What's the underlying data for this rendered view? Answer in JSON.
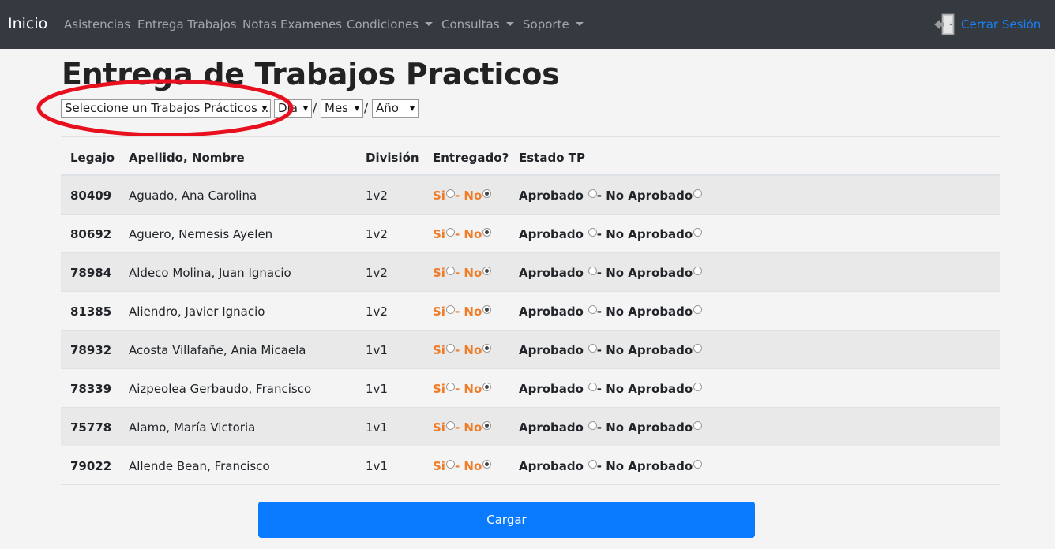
{
  "navbar": {
    "brand": "Inicio",
    "items": [
      {
        "label": "Asistencias",
        "dropdown": false
      },
      {
        "label": "Entrega Trabajos",
        "dropdown": false
      },
      {
        "label": "Notas Examenes",
        "dropdown": false
      },
      {
        "label": "Condiciones",
        "dropdown": true
      },
      {
        "label": "Consultas",
        "dropdown": true
      },
      {
        "label": "Soporte",
        "dropdown": true
      }
    ],
    "logout": {
      "label": "Cerrar Sesión",
      "icon": "logout-door-icon"
    }
  },
  "page": {
    "title": "Entrega de Trabajos Practicos",
    "selects": {
      "tp": "Seleccione un Trabajos Prácticos ...",
      "dia": "Día",
      "mes": "Mes",
      "anio": "Año"
    }
  },
  "table": {
    "headers": {
      "legajo": "Legajo",
      "nombre": "Apellido, Nombre",
      "division": "División",
      "entregado": "Entregado?",
      "estado": "Estado TP"
    },
    "labels": {
      "si": "Si",
      "sep": "- ",
      "no": "No",
      "aprobado": "Aprobado",
      "sep2": "- ",
      "no_aprobado": "No Aprobado"
    },
    "rows": [
      {
        "legajo": "80409",
        "nombre": "Aguado, Ana Carolina",
        "division": "1v2"
      },
      {
        "legajo": "80692",
        "nombre": "Aguero, Nemesis Ayelen",
        "division": "1v2"
      },
      {
        "legajo": "78984",
        "nombre": "Aldeco Molina, Juan Ignacio",
        "division": "1v2"
      },
      {
        "legajo": "81385",
        "nombre": "Aliendro, Javier Ignacio",
        "division": "1v2"
      },
      {
        "legajo": "78932",
        "nombre": "Acosta Villafañe, Ania Micaela",
        "division": "1v1"
      },
      {
        "legajo": "78339",
        "nombre": "Aizpeolea Gerbaudo, Francisco",
        "division": "1v1"
      },
      {
        "legajo": "75778",
        "nombre": "Alamo, María Victoria",
        "division": "1v1"
      },
      {
        "legajo": "79022",
        "nombre": "Allende Bean, Francisco",
        "division": "1v1"
      }
    ]
  },
  "submit": {
    "label": "Cargar"
  },
  "colors": {
    "navbar": "#343a40",
    "link": "#1a7ff5",
    "accent": "#f07c27",
    "button": "#0a7bff",
    "annotation": "#e8101e"
  }
}
